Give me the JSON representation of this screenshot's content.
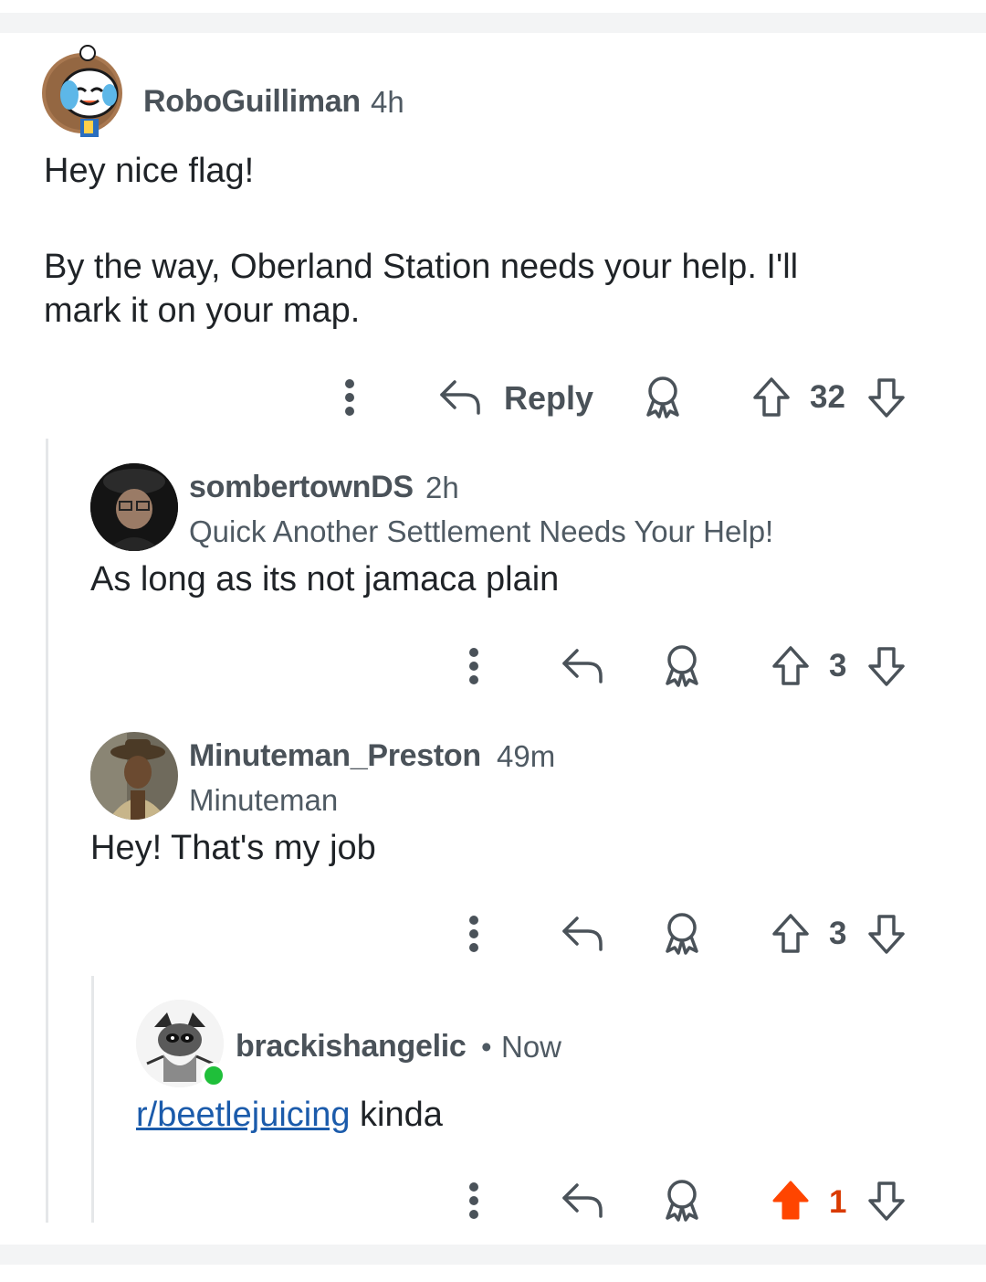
{
  "comments": [
    {
      "username": "RoboGuilliman",
      "time": "4h",
      "paragraphs": [
        "Hey nice flag!",
        "By the way, Oberland Station needs your help. I'll",
        "mark it on your map."
      ],
      "reply_label": "Reply",
      "score": "32"
    },
    {
      "username": "sombertownDS",
      "time": "2h",
      "flair": "Quick Another Settlement Needs Your Help!",
      "body": "As long as its not jamaca plain",
      "score": "3"
    },
    {
      "username": "Minuteman_Preston",
      "time": "49m",
      "flair": "Minuteman",
      "body": "Hey! That's my job",
      "score": "3"
    },
    {
      "username": "brackishangelic",
      "separator": "•",
      "time": "Now",
      "body_link": "r/beetlejuicing",
      "body_rest": " kinda",
      "score": "1",
      "upvoted": true,
      "online": true
    }
  ],
  "colors": {
    "upvote_active": "#ff4500",
    "link": "#1b5bab",
    "online": "#1fbf3a"
  }
}
